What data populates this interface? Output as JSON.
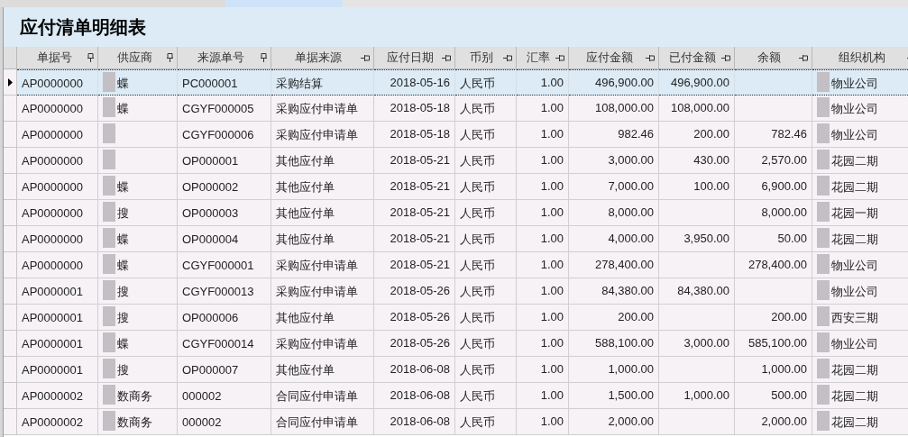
{
  "title": "应付清单明细表",
  "table": {
    "columns": [
      {
        "label": "单据号",
        "pinned": true
      },
      {
        "label": "供应商",
        "pinned": true
      },
      {
        "label": "来源单号",
        "pinned": true
      },
      {
        "label": "单据来源",
        "pinned": false
      },
      {
        "label": "应付日期",
        "pinned": false
      },
      {
        "label": "币别",
        "pinned": false
      },
      {
        "label": "汇率",
        "pinned": false
      },
      {
        "label": "应付金额",
        "pinned": false
      },
      {
        "label": "已付金额",
        "pinned": false
      },
      {
        "label": "余额",
        "pinned": false
      },
      {
        "label": "组织机构",
        "pinned": false
      }
    ],
    "rows": [
      {
        "selected": true,
        "cells": [
          "AP0000000",
          "蝶",
          "PC000001",
          "采购结算",
          "2018-05-16",
          "人民币",
          "1.00",
          "496,900.00",
          "496,900.00",
          null,
          "物业公司"
        ]
      },
      {
        "selected": false,
        "cells": [
          "AP0000000",
          "蝶",
          "CGYF000005",
          "采购应付申请单",
          "2018-05-18",
          "人民币",
          "1.00",
          "108,000.00",
          "108,000.00",
          null,
          "物业公司"
        ]
      },
      {
        "selected": false,
        "cells": [
          "AP0000000",
          null,
          "CGYF000006",
          "采购应付申请单",
          "2018-05-18",
          "人民币",
          "1.00",
          "982.46",
          "200.00",
          "782.46",
          "物业公司"
        ]
      },
      {
        "selected": false,
        "cells": [
          "AP0000000",
          null,
          "OP000001",
          "其他应付单",
          "2018-05-21",
          "人民币",
          "1.00",
          "3,000.00",
          "430.00",
          "2,570.00",
          "花园二期"
        ]
      },
      {
        "selected": false,
        "cells": [
          "AP0000000",
          "蝶",
          "OP000002",
          "其他应付单",
          "2018-05-21",
          "人民币",
          "1.00",
          "7,000.00",
          "100.00",
          "6,900.00",
          "花园二期"
        ]
      },
      {
        "selected": false,
        "cells": [
          "AP0000000",
          "搜",
          "OP000003",
          "其他应付单",
          "2018-05-21",
          "人民币",
          "1.00",
          "8,000.00",
          null,
          "8,000.00",
          "花园一期"
        ]
      },
      {
        "selected": false,
        "cells": [
          "AP0000000",
          "蝶",
          "OP000004",
          "其他应付单",
          "2018-05-21",
          "人民币",
          "1.00",
          "4,000.00",
          "3,950.00",
          "50.00",
          "花园二期"
        ]
      },
      {
        "selected": false,
        "cells": [
          "AP0000000",
          "蝶",
          "CGYF000001",
          "采购应付申请单",
          "2018-05-21",
          "人民币",
          "1.00",
          "278,400.00",
          null,
          "278,400.00",
          "物业公司"
        ]
      },
      {
        "selected": false,
        "cells": [
          "AP0000001",
          "搜",
          "CGYF000013",
          "采购应付申请单",
          "2018-05-26",
          "人民币",
          "1.00",
          "84,380.00",
          "84,380.00",
          null,
          "物业公司"
        ]
      },
      {
        "selected": false,
        "cells": [
          "AP0000001",
          "搜",
          "OP000006",
          "其他应付单",
          "2018-05-26",
          "人民币",
          "1.00",
          "200.00",
          null,
          "200.00",
          "西安三期"
        ]
      },
      {
        "selected": false,
        "cells": [
          "AP0000001",
          "蝶",
          "CGYF000014",
          "采购应付申请单",
          "2018-05-26",
          "人民币",
          "1.00",
          "588,100.00",
          "3,000.00",
          "585,100.00",
          "物业公司"
        ]
      },
      {
        "selected": false,
        "cells": [
          "AP0000001",
          "搜",
          "OP000007",
          "其他应付单",
          "2018-06-08",
          "人民币",
          "1.00",
          "1,000.00",
          null,
          "1,000.00",
          "花园二期"
        ]
      },
      {
        "selected": false,
        "cells": [
          "AP0000002",
          "数商务",
          "000002",
          "合同应付申请单",
          "2018-06-08",
          "人民币",
          "1.00",
          "1,500.00",
          "1,000.00",
          "500.00",
          "花园二期"
        ]
      },
      {
        "selected": false,
        "cells": [
          "AP0000002",
          "数商务",
          "000002",
          "合同应付申请单",
          "2018-06-08",
          "人民币",
          "1.00",
          "2,000.00",
          null,
          "2,000.00",
          "花园二期"
        ]
      }
    ]
  }
}
